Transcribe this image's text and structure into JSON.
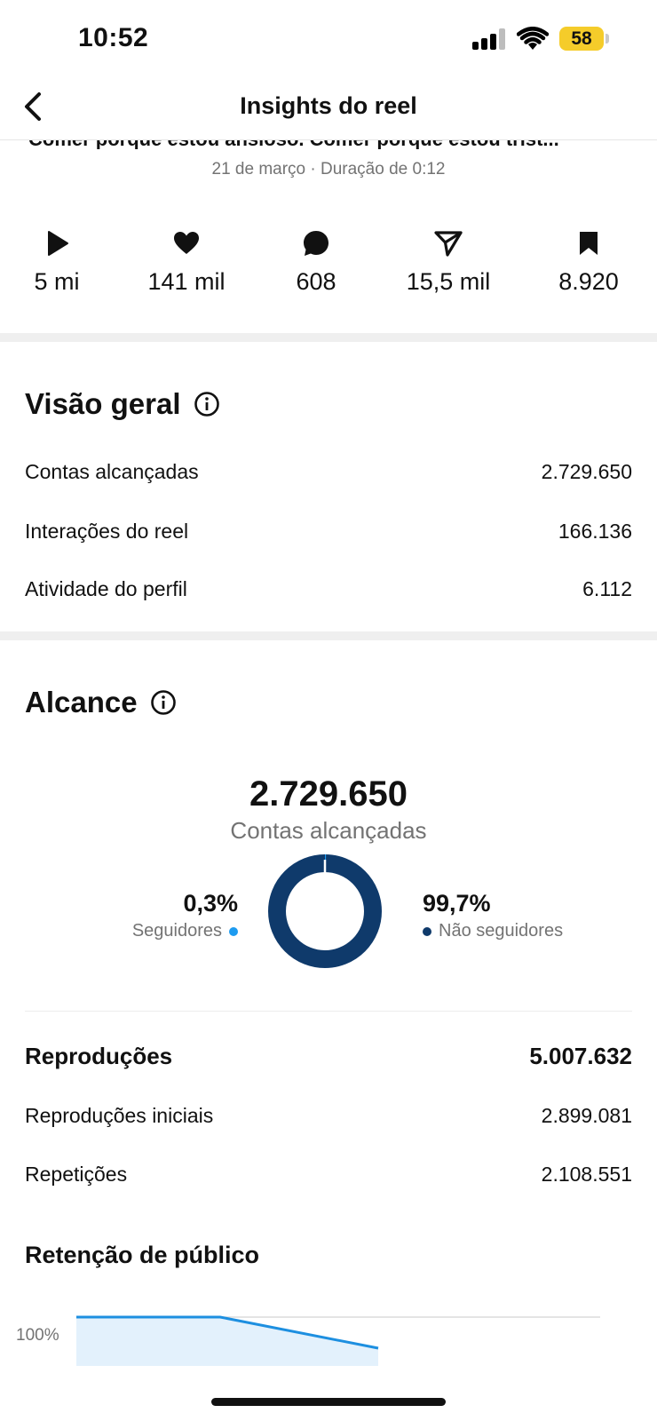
{
  "status_bar": {
    "time": "10:52",
    "battery": "58"
  },
  "header": {
    "title": "Insights do reel"
  },
  "post": {
    "caption": "Comer porque estou ansioso. Comer porque estou trist...",
    "meta": "21 de março · Duração de 0:12"
  },
  "stats": [
    {
      "icon": "play-icon",
      "value": "5 mi"
    },
    {
      "icon": "heart-icon",
      "value": "141 mil"
    },
    {
      "icon": "comment-icon",
      "value": "608"
    },
    {
      "icon": "send-icon",
      "value": "15,5 mil"
    },
    {
      "icon": "bookmark-icon",
      "value": "8.920"
    }
  ],
  "overview": {
    "title": "Visão geral",
    "rows": [
      {
        "label": "Contas alcançadas",
        "value": "2.729.650"
      },
      {
        "label": "Interações do reel",
        "value": "166.136"
      },
      {
        "label": "Atividade do perfil",
        "value": "6.112"
      }
    ]
  },
  "reach": {
    "title": "Alcance",
    "total": "2.729.650",
    "total_label": "Contas alcançadas",
    "followers_pct": "0,3%",
    "followers_label": "Seguidores",
    "non_followers_pct": "99,7%",
    "non_followers_label": "Não seguidores",
    "followers_fraction": 0.003,
    "followers_color": "#1d9bf0",
    "non_followers_color": "#0f3a6b"
  },
  "plays": {
    "title": "Reproduções",
    "total": "5.007.632",
    "rows": [
      {
        "label": "Reproduções iniciais",
        "value": "2.899.081"
      },
      {
        "label": "Repetições",
        "value": "2.108.551"
      }
    ]
  },
  "retention": {
    "title": "Retenção de público",
    "y_tick": "100%",
    "line_color": "#1d8fe0"
  }
}
